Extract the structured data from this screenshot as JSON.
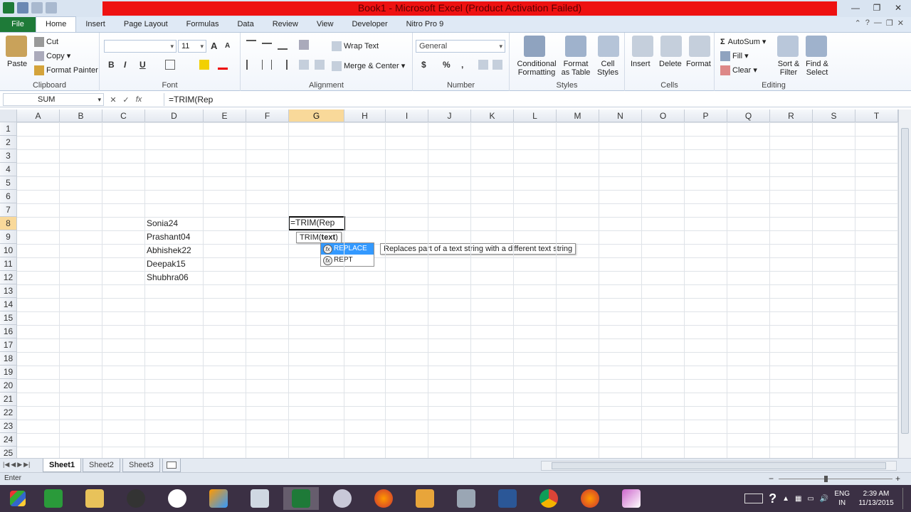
{
  "window": {
    "title": "Book1 - Microsoft Excel (Product Activation Failed)"
  },
  "ribbon": {
    "tabs": [
      {
        "label": "File"
      },
      {
        "label": "Home"
      },
      {
        "label": "Insert"
      },
      {
        "label": "Page Layout"
      },
      {
        "label": "Formulas"
      },
      {
        "label": "Data"
      },
      {
        "label": "Review"
      },
      {
        "label": "View"
      },
      {
        "label": "Developer"
      },
      {
        "label": "Nitro Pro 9"
      }
    ],
    "clipboard": {
      "paste": "Paste",
      "cut": "Cut",
      "copy": "Copy",
      "format_painter": "Format Painter",
      "label": "Clipboard"
    },
    "font": {
      "font_name": "",
      "font_size": "11",
      "bold": "B",
      "italic": "I",
      "underline": "U",
      "grow": "A",
      "shrink": "A",
      "label": "Font"
    },
    "alignment": {
      "wrap_text": "Wrap Text",
      "merge_center": "Merge & Center",
      "label": "Alignment"
    },
    "number": {
      "format": "General",
      "currency": "$",
      "percent": "%",
      "comma": ",",
      "label": "Number"
    },
    "styles": {
      "conditional_formatting_1": "Conditional",
      "conditional_formatting_2": "Formatting",
      "format_table_1": "Format",
      "format_table_2": "as Table",
      "cell_styles_1": "Cell",
      "cell_styles_2": "Styles",
      "label": "Styles"
    },
    "cells": {
      "insert": "Insert",
      "delete": "Delete",
      "format": "Format",
      "label": "Cells"
    },
    "editing": {
      "autosum": "AutoSum",
      "fill": "Fill",
      "clear": "Clear",
      "sort_filter_1": "Sort &",
      "sort_filter_2": "Filter",
      "find_select_1": "Find &",
      "find_select_2": "Select",
      "label": "Editing"
    }
  },
  "formula_bar": {
    "name_box": "SUM",
    "cancel": "✕",
    "enter": "✓",
    "fx": "fx",
    "formula": "=TRIM(Rep"
  },
  "grid": {
    "columns": [
      "A",
      "B",
      "C",
      "D",
      "E",
      "F",
      "G",
      "H",
      "I",
      "J",
      "K",
      "L",
      "M",
      "N",
      "O",
      "P",
      "Q",
      "R",
      "S",
      "T"
    ],
    "rows": [
      "1",
      "2",
      "3",
      "4",
      "5",
      "6",
      "7",
      "8",
      "9",
      "10",
      "11",
      "12",
      "13",
      "14",
      "15",
      "16",
      "17",
      "18",
      "19",
      "20",
      "21",
      "22",
      "23",
      "24",
      "25"
    ],
    "selected_column": "G",
    "selected_row": "8",
    "cells": [
      {
        "ref": "D8",
        "value": "Sonia24"
      },
      {
        "ref": "D9",
        "value": "Prashant04"
      },
      {
        "ref": "D10",
        "value": "Abhishek22"
      },
      {
        "ref": "D11",
        "value": "Deepak15"
      },
      {
        "ref": "D12",
        "value": "Shubhra06"
      }
    ],
    "active_cell": {
      "ref": "G8",
      "value": "=TRIM(Rep"
    }
  },
  "autocomplete": {
    "syntax_fn": "TRIM(",
    "syntax_arg": "text",
    "syntax_close": ")",
    "items": [
      {
        "label": "REPLACE",
        "highlighted": true
      },
      {
        "label": "REPT",
        "highlighted": false
      }
    ],
    "description": "Replaces part of a text string with a different text string"
  },
  "sheets": {
    "tabs": [
      {
        "label": "Sheet1",
        "active": true
      },
      {
        "label": "Sheet2",
        "active": false
      },
      {
        "label": "Sheet3",
        "active": false
      }
    ]
  },
  "status": {
    "mode": "Enter"
  },
  "taskbar": {
    "lang_1": "ENG",
    "lang_2": "IN",
    "time": "2:39 AM",
    "date": "11/13/2015"
  },
  "colors": {
    "title_band": "#ee1111",
    "file_tab": "#1e7a38",
    "selection_header": "#f9d99a",
    "autocomplete_highlight": "#3399ff",
    "taskbar": "#3b3044"
  }
}
